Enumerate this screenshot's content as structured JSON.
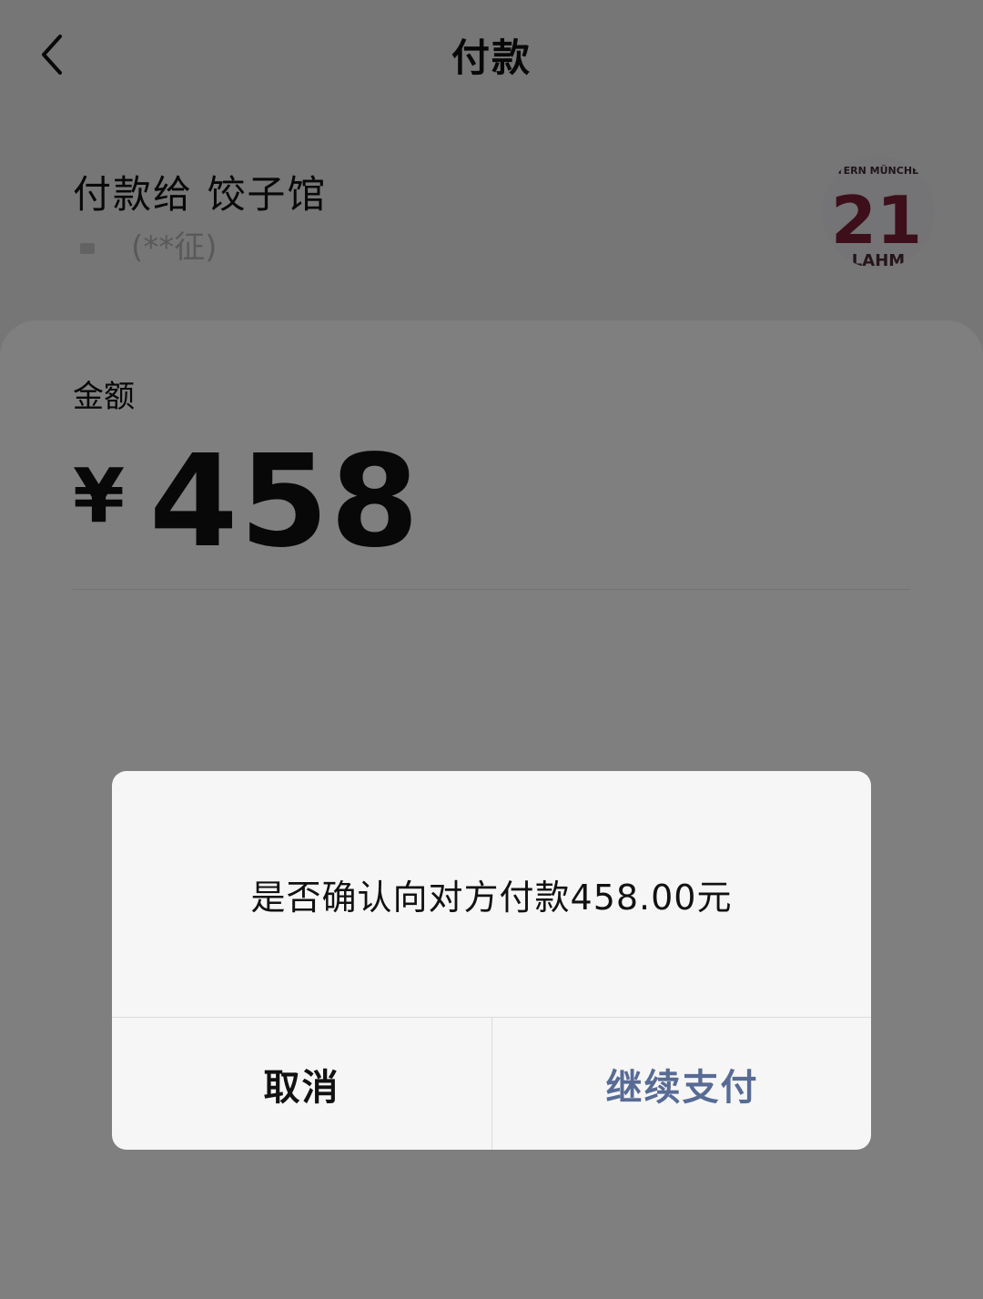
{
  "nav": {
    "title": "付款",
    "back_icon": "chevron-left-icon"
  },
  "payee": {
    "label": "付款给 饺子馆",
    "verified_text": "(**征)",
    "avatar_text_top": "AYERN MÜNCHEN",
    "avatar_number": "21",
    "avatar_text_bottom": "LAHM"
  },
  "amount": {
    "label": "金额",
    "currency": "¥",
    "value": "458"
  },
  "dialog": {
    "message": "是否确认向对方付款458.00元",
    "cancel_label": "取消",
    "confirm_label": "继续支付"
  },
  "colors": {
    "accent": "#576b95",
    "overlay": "rgba(0,0,0,0.5)"
  }
}
